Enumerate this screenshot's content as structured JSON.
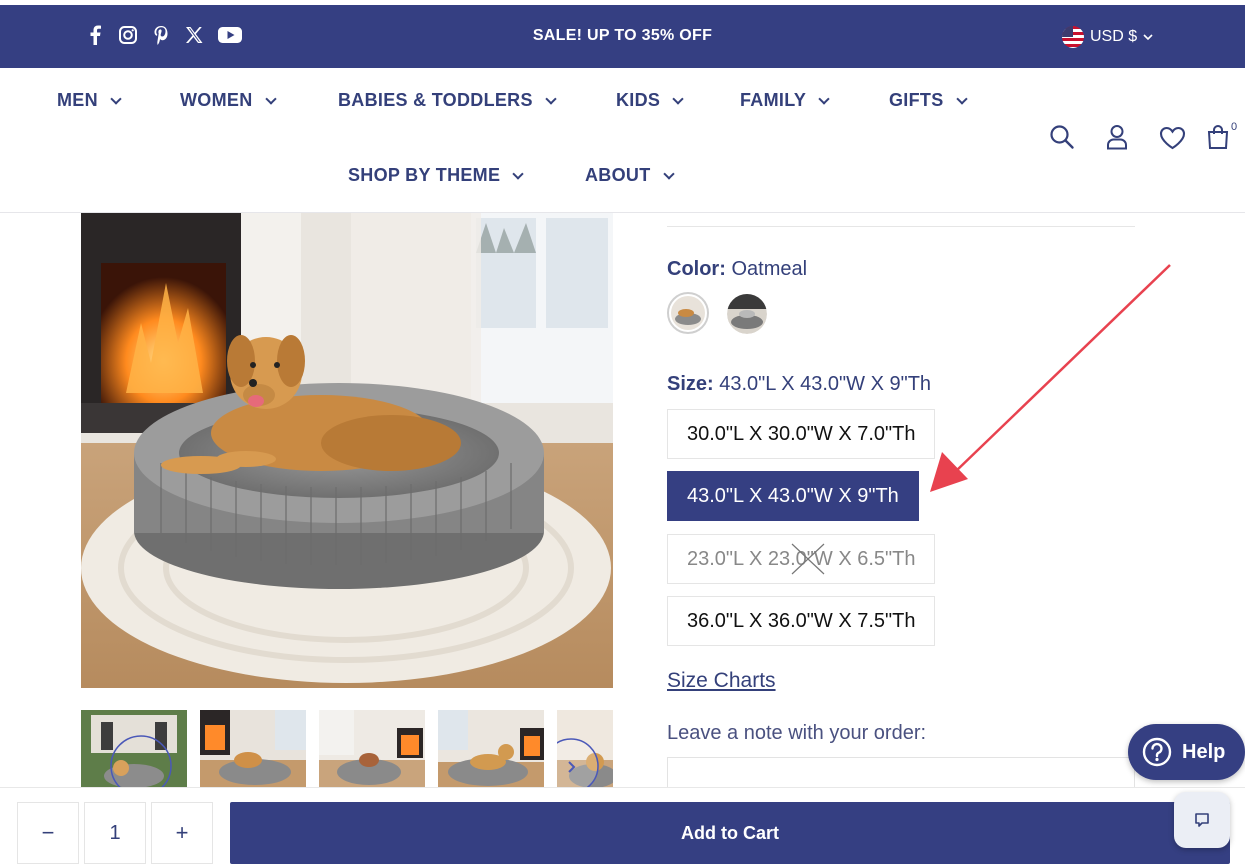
{
  "topbar": {
    "social_icons": [
      "facebook-icon",
      "instagram-icon",
      "pinterest-icon",
      "x-icon",
      "youtube-icon"
    ],
    "sale_text": "SALE! UP TO 35% OFF",
    "currency": "USD $"
  },
  "nav": {
    "items": [
      "MEN",
      "WOMEN",
      "BABIES & TODDLERS",
      "KIDS",
      "FAMILY",
      "GIFTS",
      "SHOP BY THEME",
      "ABOUT"
    ],
    "cart_count": "0"
  },
  "product": {
    "color_label": "Color:",
    "color_value": "Oatmeal",
    "size_label": "Size:",
    "size_value": "43.0\"L X 43.0\"W X 9\"Th",
    "sizes": [
      {
        "label": "30.0\"L X 30.0\"W X 7.0\"Th",
        "state": "available"
      },
      {
        "label": "43.0\"L X 43.0\"W X 9\"Th",
        "state": "selected"
      },
      {
        "label": "23.0\"L X 23.0\"W X 6.5\"Th",
        "state": "unavailable"
      },
      {
        "label": "36.0\"L X 36.0\"W X 7.5\"Th",
        "state": "available"
      }
    ],
    "size_charts_link": "Size Charts",
    "note_label": "Leave a note with your order:"
  },
  "cartbar": {
    "minus": "−",
    "quantity": "1",
    "plus": "+",
    "add_to_cart": "Add to Cart"
  },
  "help": {
    "label": "Help"
  },
  "colors": {
    "brand": "#353f82",
    "arrow": "#e8424f"
  }
}
